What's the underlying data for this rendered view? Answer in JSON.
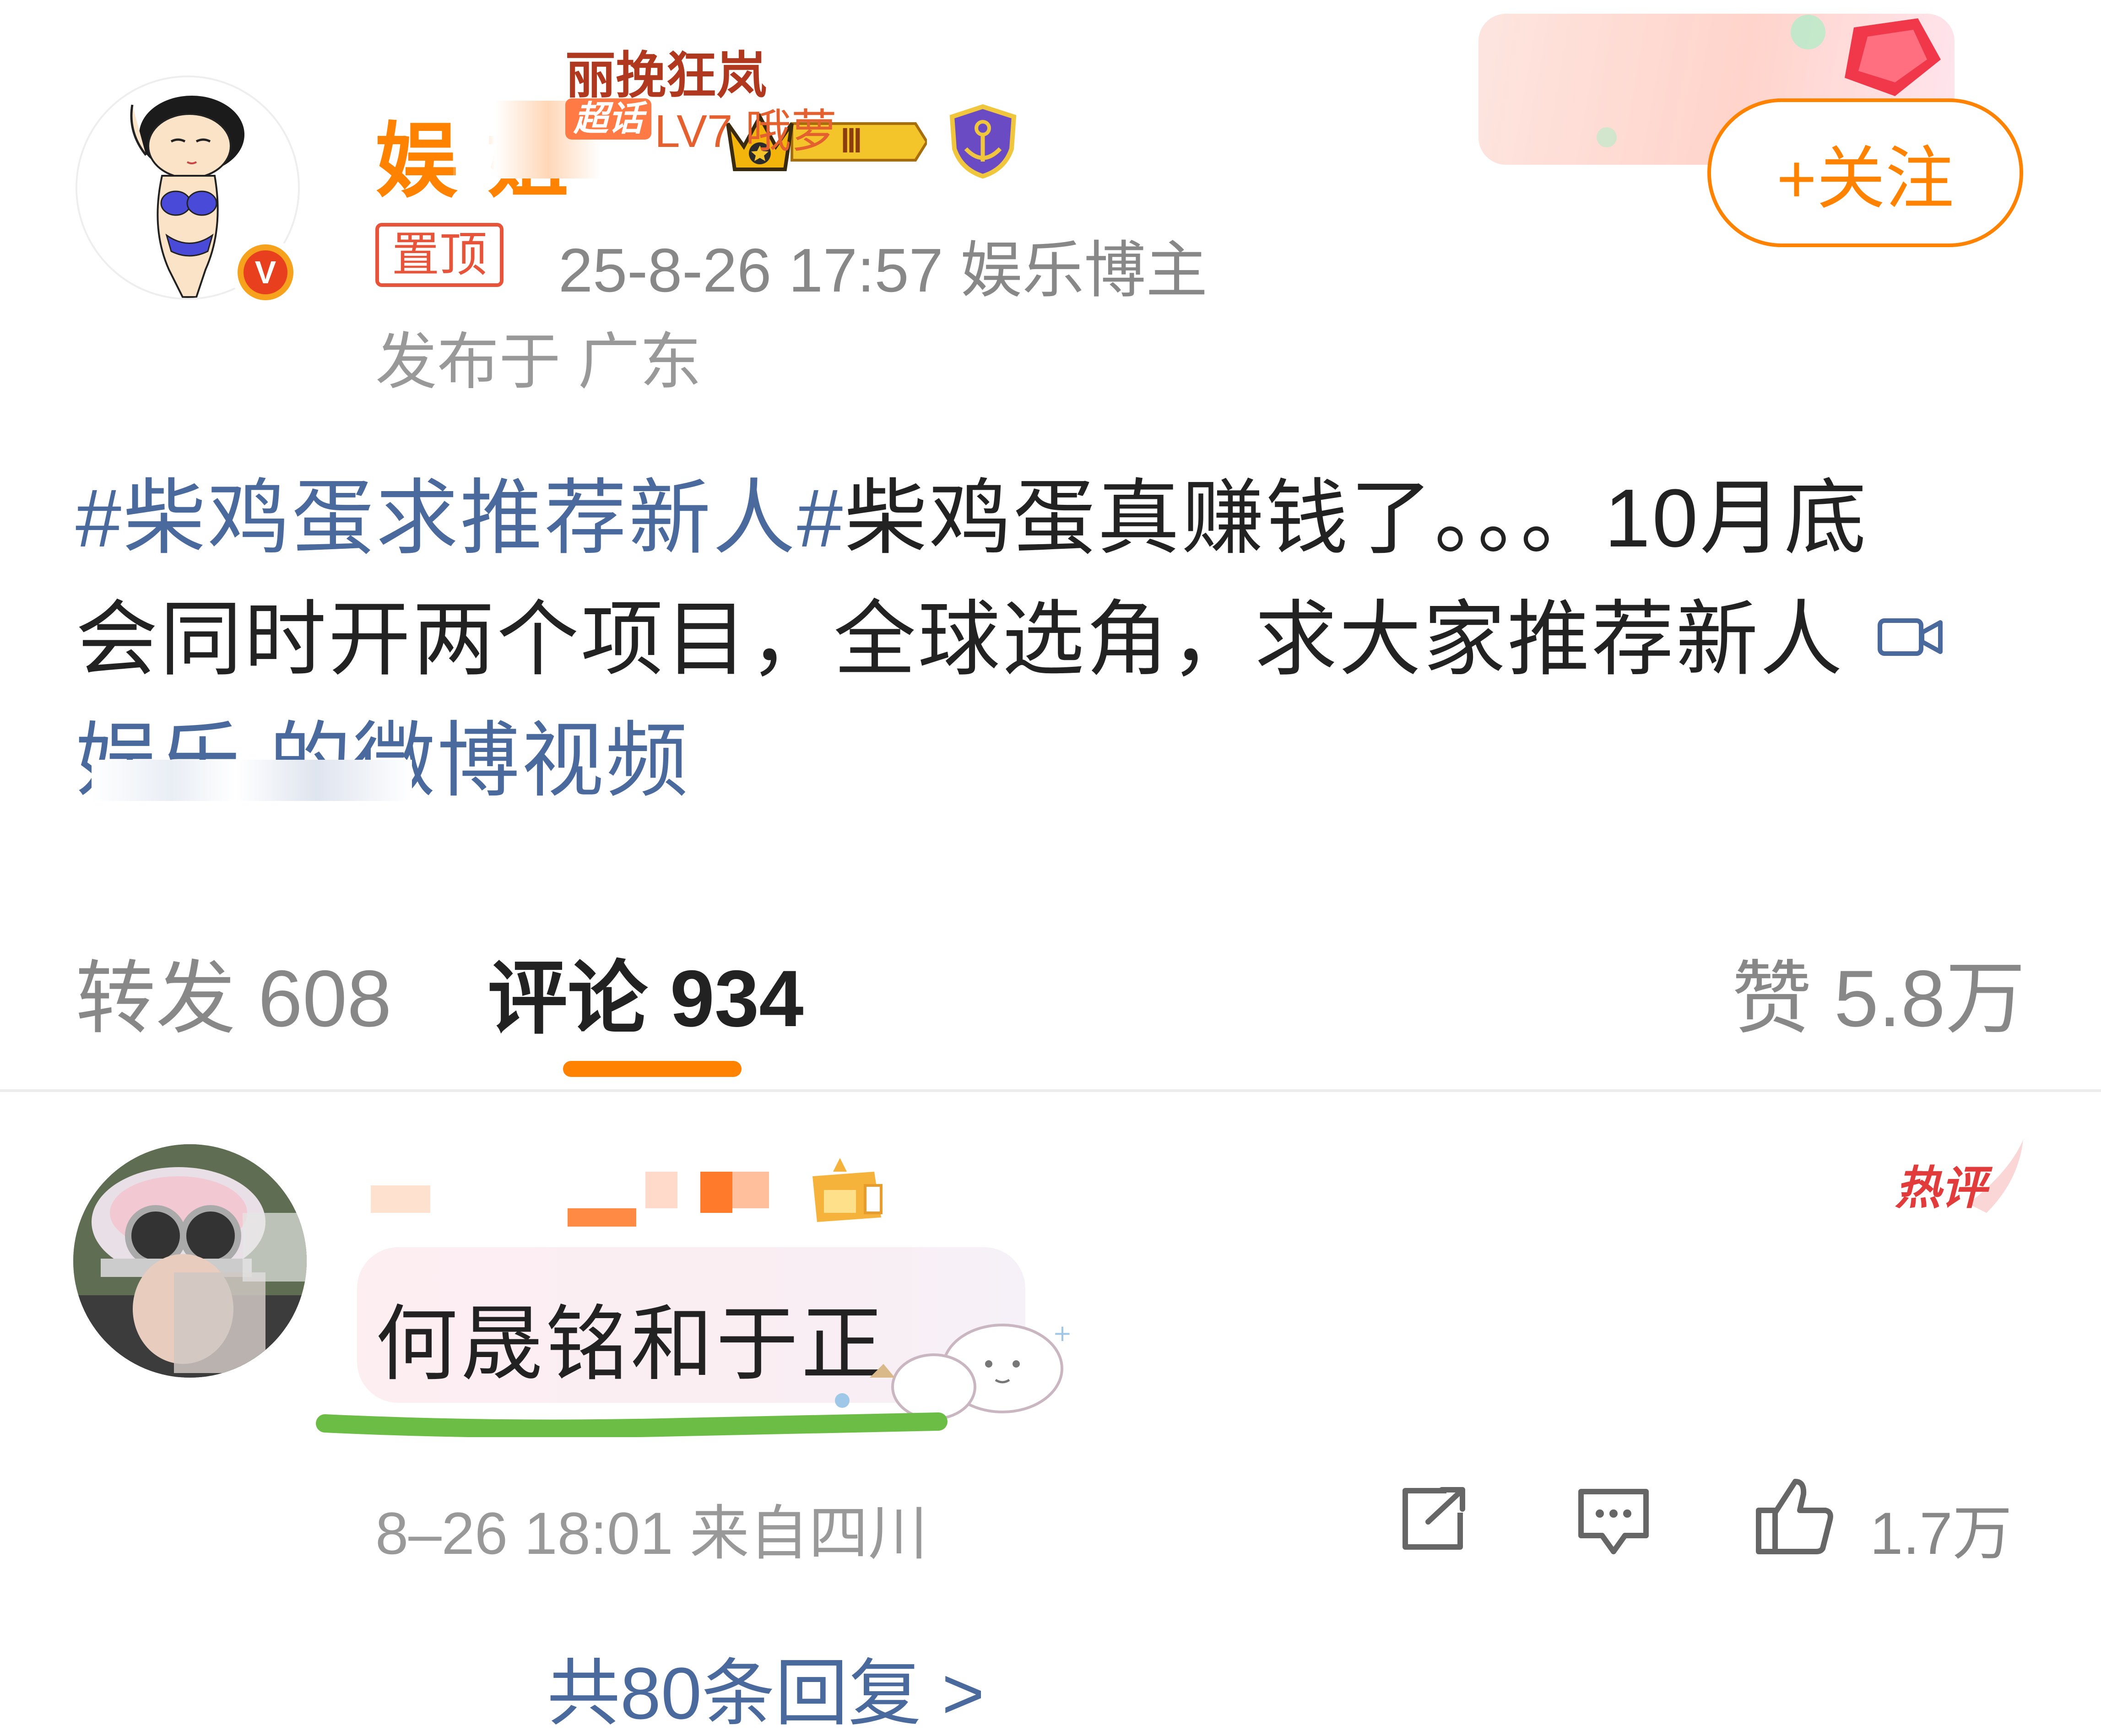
{
  "post": {
    "author": {
      "name_visible": "娱        姐",
      "avatar": "cartoon-girl-avatar",
      "verified_badge": "orange-v-icon",
      "badges": [
        "crown-level-iii-badge",
        "anchor-shield-badge"
      ]
    },
    "pin_label": "置顶",
    "meta": "25-8-26 17:57  娱乐博主",
    "location": "发布于 广东",
    "follow_label": "+关注",
    "supertopic": {
      "title": "丽挽狂岚",
      "tag": "超话",
      "level": "LV7 哦萝"
    },
    "body": {
      "hashtag": "#柴鸡蛋求推荐新人#",
      "text_line1": "柴鸡蛋真赚钱了。。。10月底",
      "text_line2": "会同时开两个项目，全球选角，求大家推荐新人",
      "video_link": "娱乐         的微博视频"
    }
  },
  "tabs": {
    "repost": "转发 608",
    "comment": "评论 934",
    "like": "赞 5.8万"
  },
  "comment": {
    "hot_badge": "热评",
    "text": "何晟铭和于正",
    "meta": "8–26 18:01 来自四川",
    "like_count": "1.7万",
    "replies_link": "共80条回复 >"
  },
  "colors": {
    "accent": "#ff8200",
    "link": "#4a6a9d",
    "pin": "#e8543a",
    "muted": "#888888",
    "highlight_line": "#6cbd45"
  }
}
